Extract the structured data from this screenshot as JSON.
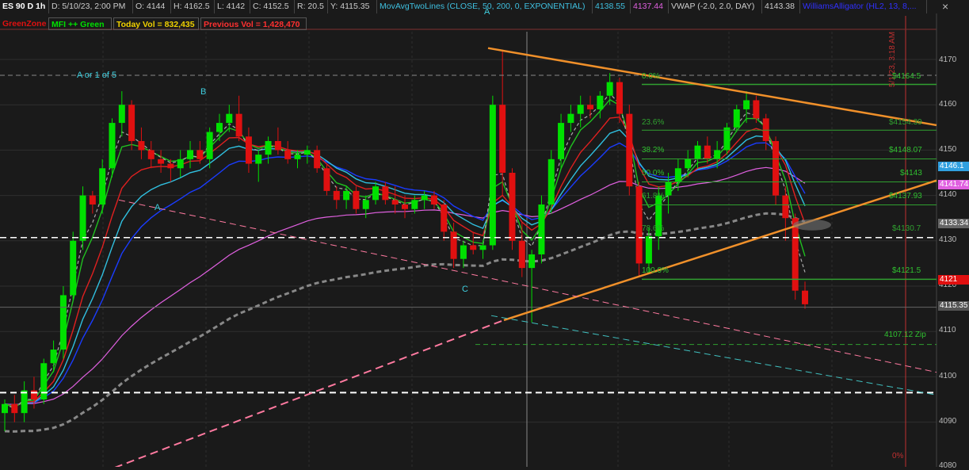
{
  "header": {
    "symbol": "ES 90 D 1h",
    "date": "D: 5/10/23, 2:00 PM",
    "open": "O: 4144",
    "high": "H: 4162.5",
    "low": "L: 4142",
    "close": "C: 4152.5",
    "range": "R: 20.5",
    "y_value": "Y: 4115.35",
    "study_mavg": "MovAvgTwoLines (CLOSE, 50, 200, 0, EXPONENTIAL)",
    "mavg_val1": "4138.55",
    "mavg_val2": "4137.44",
    "study_vwap": "VWAP (-2.0, 2.0, DAY)",
    "vwap_val": "4143.38",
    "study_alligator": "WilliamsAlligator (HL2, 13, 8,...",
    "close_icon": "×"
  },
  "labels_row": {
    "greenzone": "GreenZone",
    "mfi": "MFI ++ Green",
    "today_vol": "Today Vol = 832,435",
    "prev_vol": "Previous Vol = 1,428,470"
  },
  "annotations": {
    "a_or_1": "A or 1 of 5",
    "b": "B",
    "a": "A",
    "c": "C",
    "a_top": "A",
    "vertical_time": "5/1/23, 3:18 AM"
  },
  "fib": {
    "f0": "0.0%",
    "f236": "23.6%",
    "f382": "38.2%",
    "f50": "50.0%",
    "f618": "61.8%",
    "f786": "78.6%",
    "f100": "100.0%",
    "v4164": "$4164.5",
    "v4154": "$4154.39",
    "v4148": "$4148.07",
    "v4143": "$4143",
    "v4137": "$4137.93",
    "v4130": "$4130.7",
    "v4121": "$4121.5",
    "zip": "4107.12 Zip",
    "bottom_pct": "0%"
  },
  "price_tags": {
    "t1": "4146.1",
    "t2": "4141.74",
    "t3": "4133.34",
    "t4": "4121",
    "t5": "4115.35"
  },
  "colors": {
    "background": "#1a1a1a",
    "grid": "#2e2e2e",
    "up_candle": "#00e000",
    "down_candle": "#e01010",
    "neutral_candle": "#8a8a8a",
    "trendline_orange": "#f0902a",
    "dashed_pink": "#ff7aa0",
    "dashed_cyan": "#40c0c0",
    "fib_green": "#30a030"
  },
  "chart_data": {
    "type": "candlestick",
    "title": "ES 90 D 1h",
    "y_axis_ticks": [
      4080,
      4090,
      4100,
      4110,
      4120,
      4130,
      4140,
      4150,
      4160,
      4170
    ],
    "ylim": [
      4080,
      4177
    ],
    "candles": [
      [
        4092,
        4095,
        4088,
        4094
      ],
      [
        4094,
        4096,
        4090,
        4092
      ],
      [
        4092,
        4099,
        4090,
        4097
      ],
      [
        4097,
        4100,
        4093,
        4095
      ],
      [
        4095,
        4104,
        4094,
        4103
      ],
      [
        4103,
        4108,
        4101,
        4106
      ],
      [
        4106,
        4120,
        4104,
        4118
      ],
      [
        4118,
        4132,
        4117,
        4130
      ],
      [
        4130,
        4142,
        4128,
        4140
      ],
      [
        4140,
        4141,
        4136,
        4138
      ],
      [
        4138,
        4148,
        4136,
        4146
      ],
      [
        4146,
        4157,
        4144,
        4156
      ],
      [
        4156,
        4163,
        4153,
        4160
      ],
      [
        4160,
        4161,
        4150,
        4152
      ],
      [
        4152,
        4155,
        4148,
        4150
      ],
      [
        4150,
        4152,
        4146,
        4148
      ],
      [
        4148,
        4150,
        4145,
        4147
      ],
      [
        4147,
        4148,
        4143,
        4146
      ],
      [
        4146,
        4150,
        4144,
        4148
      ],
      [
        4148,
        4152,
        4146,
        4150
      ],
      [
        4150,
        4152,
        4147,
        4148
      ],
      [
        4148,
        4155,
        4146,
        4154
      ],
      [
        4154,
        4158,
        4152,
        4156
      ],
      [
        4156,
        4160,
        4154,
        4158
      ],
      [
        4158,
        4162,
        4152,
        4153
      ],
      [
        4153,
        4155,
        4145,
        4147
      ],
      [
        4147,
        4150,
        4143,
        4149
      ],
      [
        4149,
        4153,
        4147,
        4152
      ],
      [
        4152,
        4155,
        4149,
        4150
      ],
      [
        4150,
        4152,
        4147,
        4148
      ],
      [
        4148,
        4150,
        4146,
        4149
      ],
      [
        4149,
        4151,
        4147,
        4150
      ],
      [
        4150,
        4151,
        4145,
        4146
      ],
      [
        4146,
        4147,
        4140,
        4141
      ],
      [
        4141,
        4142,
        4137,
        4139
      ],
      [
        4139,
        4142,
        4137,
        4141
      ],
      [
        4141,
        4142,
        4136,
        4137
      ],
      [
        4137,
        4140,
        4135,
        4139
      ],
      [
        4139,
        4143,
        4138,
        4142
      ],
      [
        4142,
        4143,
        4138,
        4139
      ],
      [
        4139,
        4142,
        4136,
        4138
      ],
      [
        4138,
        4140,
        4135,
        4137
      ],
      [
        4137,
        4140,
        4136,
        4139
      ],
      [
        4139,
        4141,
        4137,
        4140
      ],
      [
        4140,
        4141,
        4137,
        4138
      ],
      [
        4138,
        4139,
        4130,
        4132
      ],
      [
        4132,
        4134,
        4124,
        4126
      ],
      [
        4126,
        4130,
        4124,
        4129
      ],
      [
        4129,
        4132,
        4127,
        4128
      ],
      [
        4128,
        4130,
        4126,
        4129
      ],
      [
        4129,
        4162,
        4128,
        4160
      ],
      [
        4160,
        4172,
        4140,
        4145
      ],
      [
        4145,
        4146,
        4128,
        4130
      ],
      [
        4130,
        4134,
        4122,
        4124
      ],
      [
        4124,
        4128,
        4112,
        4127
      ],
      [
        4127,
        4140,
        4125,
        4138
      ],
      [
        4138,
        4150,
        4136,
        4148
      ],
      [
        4148,
        4158,
        4146,
        4156
      ],
      [
        4156,
        4160,
        4154,
        4158
      ],
      [
        4158,
        4162,
        4155,
        4160
      ],
      [
        4160,
        4162,
        4157,
        4159
      ],
      [
        4159,
        4163,
        4157,
        4162
      ],
      [
        4162,
        4167,
        4160,
        4165
      ],
      [
        4165,
        4166,
        4156,
        4158
      ],
      [
        4158,
        4160,
        4140,
        4142
      ],
      [
        4142,
        4143,
        4122,
        4125
      ],
      [
        4125,
        4133,
        4123,
        4131
      ],
      [
        4131,
        4142,
        4128,
        4140
      ],
      [
        4140,
        4145,
        4136,
        4143
      ],
      [
        4143,
        4148,
        4141,
        4146
      ],
      [
        4146,
        4150,
        4144,
        4148
      ],
      [
        4148,
        4152,
        4146,
        4151
      ],
      [
        4151,
        4153,
        4147,
        4148
      ],
      [
        4148,
        4152,
        4146,
        4150
      ],
      [
        4150,
        4156,
        4149,
        4155
      ],
      [
        4155,
        4160,
        4154,
        4159
      ],
      [
        4159,
        4163,
        4156,
        4161
      ],
      [
        4161,
        4162,
        4156,
        4157
      ],
      [
        4157,
        4158,
        4150,
        4152
      ],
      [
        4152,
        4153,
        4138,
        4140
      ],
      [
        4140,
        4142,
        4130,
        4135
      ],
      [
        4135,
        4136,
        4117,
        4119
      ],
      [
        4119,
        4121,
        4115,
        4116
      ]
    ]
  }
}
